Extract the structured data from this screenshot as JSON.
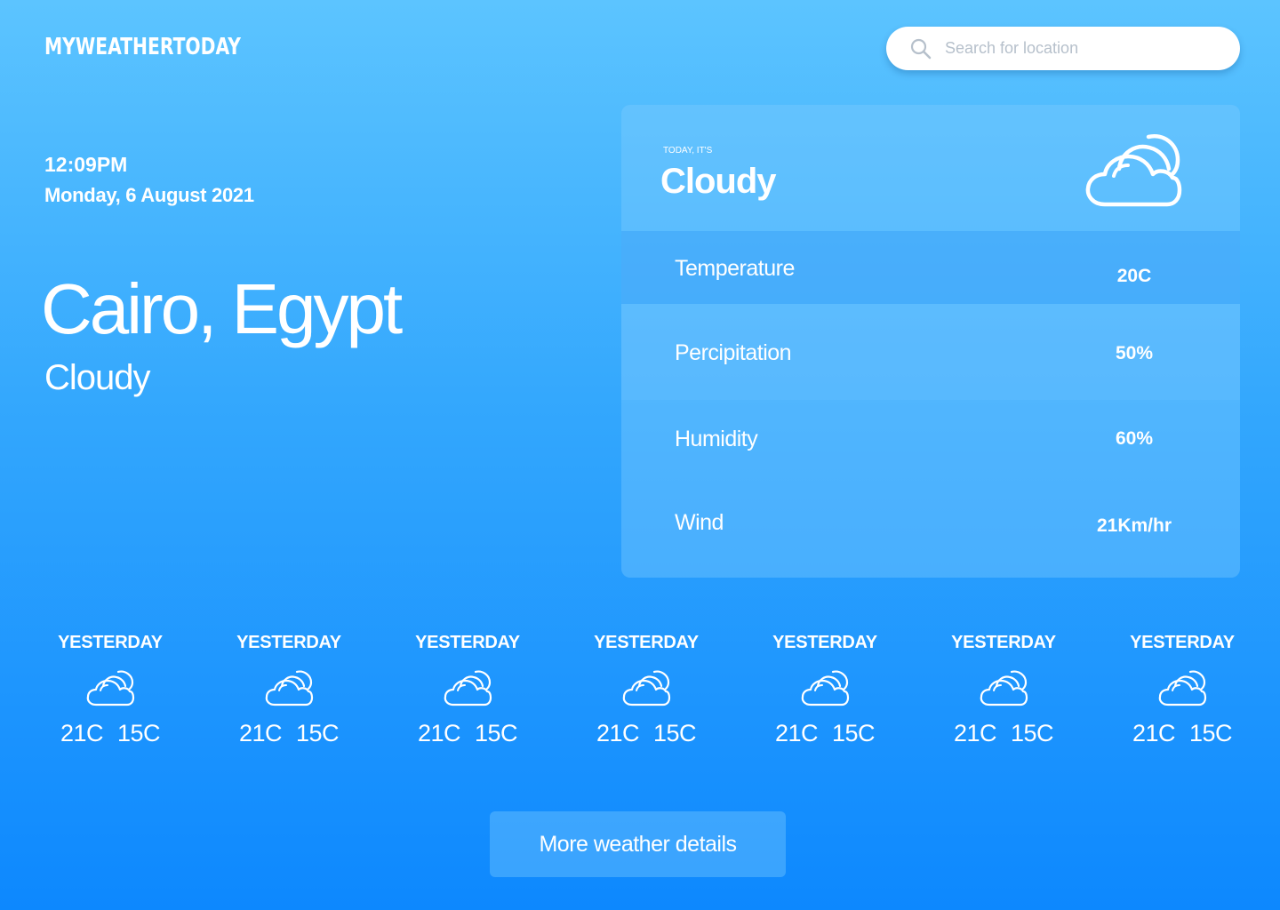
{
  "header": {
    "logo": "MYWEATHERTODAY",
    "search_placeholder": "Search for location",
    "search_icon": "search-icon"
  },
  "location": {
    "time": "12:09PM",
    "date": "Monday, 6 August 2021",
    "city": "Cairo, Egypt",
    "condition": "Cloudy"
  },
  "today": {
    "label": "TODAY, IT'S",
    "condition": "Cloudy",
    "icon": "cloud-sun-icon",
    "stats": [
      {
        "label": "Temperature",
        "value": "20C"
      },
      {
        "label": "Percipitation",
        "value": "50%"
      },
      {
        "label": "Humidity",
        "value": "60%"
      },
      {
        "label": "Wind",
        "value": "21Km/hr"
      }
    ]
  },
  "forecast": [
    {
      "day": "YESTERDAY",
      "icon": "cloud-sun-icon",
      "high": "21C",
      "low": "15C"
    },
    {
      "day": "YESTERDAY",
      "icon": "cloud-sun-icon",
      "high": "21C",
      "low": "15C"
    },
    {
      "day": "YESTERDAY",
      "icon": "cloud-sun-icon",
      "high": "21C",
      "low": "15C"
    },
    {
      "day": "YESTERDAY",
      "icon": "cloud-sun-icon",
      "high": "21C",
      "low": "15C"
    },
    {
      "day": "YESTERDAY",
      "icon": "cloud-sun-icon",
      "high": "21C",
      "low": "15C"
    },
    {
      "day": "YESTERDAY",
      "icon": "cloud-sun-icon",
      "high": "21C",
      "low": "15C"
    },
    {
      "day": "YESTERDAY",
      "icon": "cloud-sun-icon",
      "high": "21C",
      "low": "15C"
    }
  ],
  "more_button": "More weather details",
  "colors": {
    "gradient_top": "#5cc4ff",
    "gradient_bottom": "#0d88fe",
    "text": "#ffffff",
    "search_placeholder": "#b6c0cb"
  }
}
